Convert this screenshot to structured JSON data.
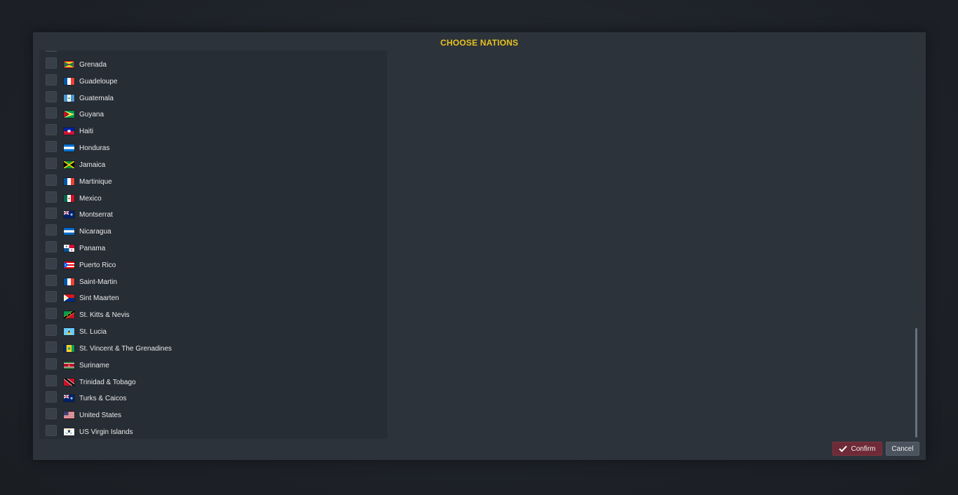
{
  "dialog": {
    "title": "CHOOSE NATIONS",
    "confirm_label": "Confirm",
    "cancel_label": "Cancel",
    "confirm_icon": "check-icon"
  },
  "nations": [
    {
      "name": "Grenada",
      "flag": "grenada",
      "checked": false
    },
    {
      "name": "Guadeloupe",
      "flag": "france",
      "checked": false
    },
    {
      "name": "Guatemala",
      "flag": "guatemala",
      "checked": false
    },
    {
      "name": "Guyana",
      "flag": "guyana",
      "checked": false
    },
    {
      "name": "Haiti",
      "flag": "haiti",
      "checked": false
    },
    {
      "name": "Honduras",
      "flag": "honduras",
      "checked": false
    },
    {
      "name": "Jamaica",
      "flag": "jamaica",
      "checked": false
    },
    {
      "name": "Martinique",
      "flag": "france",
      "checked": false
    },
    {
      "name": "Mexico",
      "flag": "mexico",
      "checked": false
    },
    {
      "name": "Montserrat",
      "flag": "blue-ensign",
      "checked": false
    },
    {
      "name": "Nicaragua",
      "flag": "nicaragua",
      "checked": false
    },
    {
      "name": "Panama",
      "flag": "panama",
      "checked": false
    },
    {
      "name": "Puerto Rico",
      "flag": "puerto-rico",
      "checked": false
    },
    {
      "name": "Saint-Martin",
      "flag": "france",
      "checked": false
    },
    {
      "name": "Sint Maarten",
      "flag": "sint-maarten",
      "checked": false
    },
    {
      "name": "St. Kitts & Nevis",
      "flag": "st-kitts",
      "checked": false
    },
    {
      "name": "St. Lucia",
      "flag": "st-lucia",
      "checked": false
    },
    {
      "name": "St. Vincent & The Grenadines",
      "flag": "st-vincent",
      "checked": false
    },
    {
      "name": "Suriname",
      "flag": "suriname",
      "checked": false
    },
    {
      "name": "Trinidad & Tobago",
      "flag": "trinidad",
      "checked": false
    },
    {
      "name": "Turks & Caicos",
      "flag": "blue-ensign",
      "checked": false
    },
    {
      "name": "United States",
      "flag": "usa",
      "checked": false
    },
    {
      "name": "US Virgin Islands",
      "flag": "usvi",
      "checked": false
    }
  ],
  "colors": {
    "title": "#e8c21f",
    "confirm": "#6f2a37",
    "cancel": "#4b535e"
  }
}
